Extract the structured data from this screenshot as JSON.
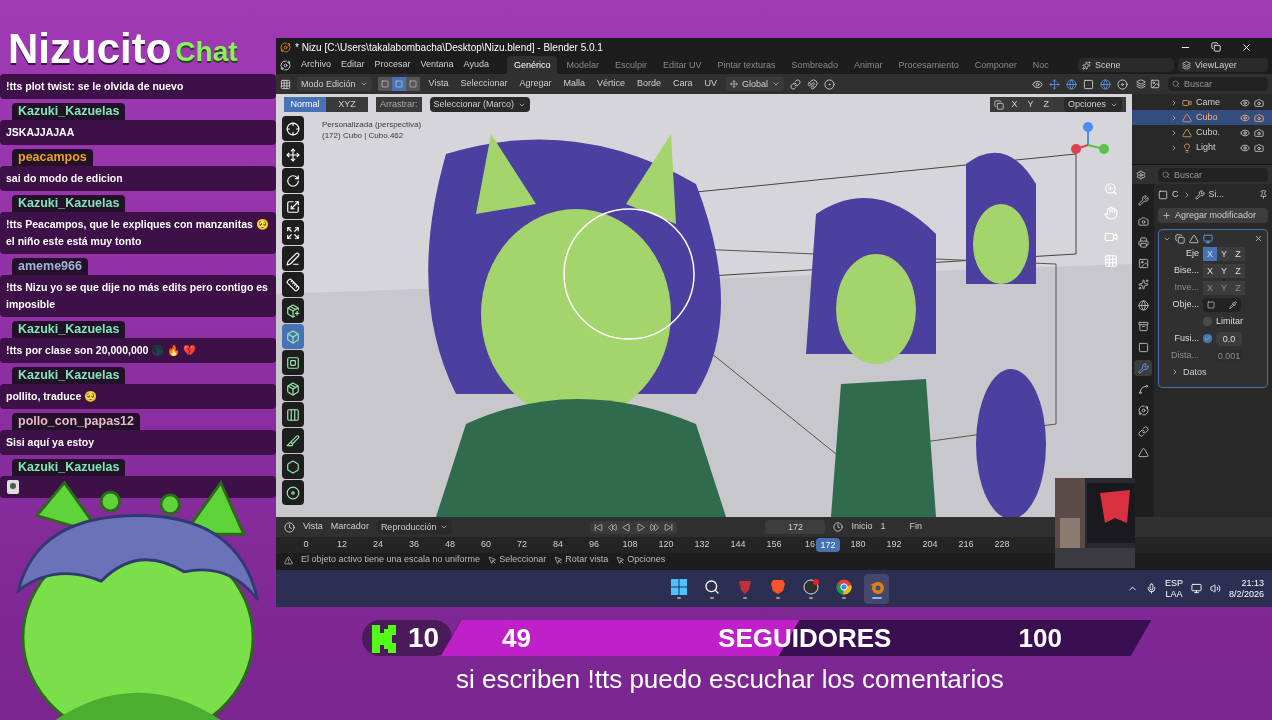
{
  "header": {
    "name": "Nizucito",
    "tag": "Chat"
  },
  "chat": [
    {
      "kind": "text",
      "text": "!tts plot twist: se le olvida de nuevo"
    },
    {
      "kind": "text",
      "user": "Kazuki_Kazuelas",
      "color": "#7ee8b8",
      "text": "JSKAJJAJAA"
    },
    {
      "kind": "text",
      "user": "peacampos",
      "color": "#e8a31c",
      "text": "sai do modo de edicion"
    },
    {
      "kind": "text",
      "user": "Kazuki_Kazuelas",
      "color": "#7ee8b8",
      "text": "!tts Peacampos, que le expliques con manzanitas 🥺 el niño este está muy tonto"
    },
    {
      "kind": "text",
      "user": "ameme966",
      "color": "#9fb4dc",
      "text": "!tts Nizu yo se que dije no más edits pero contigo es imposible"
    },
    {
      "kind": "text",
      "user": "Kazuki_Kazuelas",
      "color": "#7ee8b8",
      "text": "!tts por clase son 20,000,000 🌑 🔥 💔"
    },
    {
      "kind": "text",
      "user": "Kazuki_Kazuelas",
      "color": "#7ee8b8",
      "text": "pollito, traduce 🥺"
    },
    {
      "kind": "text",
      "user": "pollo_con_papas12",
      "color": "#e6b8c8",
      "text": "Sisi aquí ya estoy"
    },
    {
      "kind": "sticker",
      "user": "Kazuki_Kazuelas",
      "color": "#7ee8b8"
    }
  ],
  "blender": {
    "title": "* Nizu [C:\\Users\\takalabombacha\\Desktop\\Nizu.blend] - Blender 5.0.1",
    "menu": [
      "Archivo",
      "Editar",
      "Procesar",
      "Ventana",
      "Ayuda"
    ],
    "workspaces": [
      {
        "label": "Genérico",
        "selected": true
      },
      {
        "label": "Modelar",
        "selected": false
      },
      {
        "label": "Esculpir",
        "selected": false
      },
      {
        "label": "Editar UV",
        "selected": false
      },
      {
        "label": "Pintar texturas",
        "selected": false
      },
      {
        "label": "Sombreado",
        "selected": false
      },
      {
        "label": "Animar",
        "selected": false
      },
      {
        "label": "Procesamiento",
        "selected": false
      },
      {
        "label": "Componer",
        "selected": false
      },
      {
        "label": "Noc",
        "selected": false
      }
    ],
    "scene": "Scene",
    "view_layer": "ViewLayer",
    "mode": "Modo Edición",
    "select_modes": [
      {
        "selected": false
      },
      {
        "selected": true
      },
      {
        "selected": false
      }
    ],
    "header_menu": [
      "Vista",
      "Seleccionar",
      "Agregar",
      "Malla",
      "Vértice",
      "Borde",
      "Cara",
      "UV"
    ],
    "orientation": "Global",
    "orient_tabs": [
      {
        "label": "Normal",
        "selected": true
      },
      {
        "label": "XYZ",
        "selected": false
      }
    ],
    "drag_label": "Arrastrar:",
    "drag_value": "Seleccionar (Marco)",
    "mirror_axes": [
      "X",
      "Y",
      "Z"
    ],
    "options": "Opciones",
    "viewport_info": [
      "Personalizada (perspectiva)",
      "(172) Cubo | Cubo.462"
    ],
    "tools": [
      {
        "kind": "cursor",
        "selected": false
      },
      {
        "kind": "move",
        "selected": false
      },
      {
        "kind": "rotate",
        "selected": false
      },
      {
        "kind": "scale",
        "selected": false
      },
      {
        "kind": "transform",
        "selected": false
      },
      {
        "kind": "annotate",
        "selected": false
      },
      {
        "kind": "measure",
        "selected": false
      },
      {
        "kind": "add",
        "selected": false
      },
      {
        "kind": "extrude",
        "selected": true
      },
      {
        "kind": "inset",
        "selected": false
      },
      {
        "kind": "bevel",
        "selected": false
      },
      {
        "kind": "loopcut",
        "selected": false
      },
      {
        "kind": "knife",
        "selected": false
      },
      {
        "kind": "polybuild",
        "selected": false
      },
      {
        "kind": "spin",
        "selected": false
      }
    ],
    "outliner": {
      "placeholder": "Buscar",
      "items": [
        {
          "label": "Came",
          "kind": "camera",
          "selected": false
        },
        {
          "label": "Cubo",
          "kind": "mesh",
          "selected": true
        },
        {
          "label": "Cubo.",
          "kind": "mesh",
          "selected": false
        },
        {
          "label": "Light",
          "kind": "light",
          "selected": false
        }
      ]
    },
    "properties": {
      "placeholder": "Buscar",
      "tabs": [
        {
          "kind": "tool",
          "selected": false
        },
        {
          "kind": "render",
          "selected": false
        },
        {
          "kind": "output",
          "selected": false
        },
        {
          "kind": "view",
          "selected": false
        },
        {
          "kind": "scene",
          "selected": false
        },
        {
          "kind": "world",
          "selected": false
        },
        {
          "kind": "collection",
          "selected": false
        },
        {
          "kind": "object",
          "selected": false
        },
        {
          "kind": "modifier",
          "selected": true
        },
        {
          "kind": "particles",
          "selected": false
        },
        {
          "kind": "physics",
          "selected": false
        },
        {
          "kind": "constraints",
          "selected": false
        },
        {
          "kind": "data",
          "selected": false
        }
      ],
      "breadcrumb": [
        "C",
        "Si..."
      ],
      "add_button": "Agregar modificador",
      "rows": [
        {
          "kind": "axes",
          "label": "Eje",
          "disabled": false,
          "axes": [
            {
              "label": "X",
              "selected": true
            },
            {
              "label": "Y",
              "selected": false
            },
            {
              "label": "Z",
              "selected": false
            }
          ]
        },
        {
          "kind": "axes",
          "label": "Bise...",
          "disabled": false,
          "axes": [
            {
              "label": "X",
              "selected": false
            },
            {
              "label": "Y",
              "selected": false
            },
            {
              "label": "Z",
              "selected": false
            }
          ]
        },
        {
          "kind": "axes",
          "label": "Inve...",
          "disabled": true,
          "axes": [
            {
              "label": "X",
              "selected": false
            },
            {
              "label": "Y",
              "selected": false
            },
            {
              "label": "Z",
              "selected": false
            }
          ]
        },
        {
          "kind": "object",
          "label": "Obje...",
          "disabled": false
        },
        {
          "kind": "check",
          "label": "Limitar",
          "checked": false,
          "disabled": false
        },
        {
          "kind": "check_value",
          "label": "Fusi...",
          "checked": true,
          "value": "0.0",
          "disabled": false
        },
        {
          "kind": "value",
          "label": "Dista...",
          "value": "0.001",
          "disabled": true
        }
      ],
      "subpanel": "Datos"
    },
    "timeline": {
      "menu": [
        "Vista",
        "Marcador"
      ],
      "playback": "Reproducción",
      "frame": "172",
      "start_label": "Inicio",
      "start": "1",
      "end_label": "Fin",
      "ticks": [
        {
          "label": "0",
          "selected": false
        },
        {
          "label": "12",
          "selected": false
        },
        {
          "label": "24",
          "selected": false
        },
        {
          "label": "36",
          "selected": false
        },
        {
          "label": "48",
          "selected": false
        },
        {
          "label": "60",
          "selected": false
        },
        {
          "label": "72",
          "selected": false
        },
        {
          "label": "84",
          "selected": false
        },
        {
          "label": "96",
          "selected": false
        },
        {
          "label": "108",
          "selected": false
        },
        {
          "label": "120",
          "selected": false
        },
        {
          "label": "132",
          "selected": false
        },
        {
          "label": "144",
          "selected": false
        },
        {
          "label": "156",
          "selected": false
        },
        {
          "label": "16",
          "selected": false
        },
        {
          "label": "172",
          "selected": true
        },
        {
          "label": "180",
          "selected": false
        },
        {
          "label": "192",
          "selected": false
        },
        {
          "label": "204",
          "selected": false
        },
        {
          "label": "216",
          "selected": false
        },
        {
          "label": "228",
          "selected": false
        }
      ]
    },
    "status": {
      "warning": "El objeto activo tiene una escala no uniforme",
      "hints": [
        "Seleccionar",
        "Rotar vista",
        "Opciones"
      ]
    }
  },
  "taskbar": {
    "apps": [
      {
        "kind": "start",
        "selected": false
      },
      {
        "kind": "search",
        "selected": false
      },
      {
        "kind": "app",
        "selected": false
      },
      {
        "kind": "browser",
        "selected": false
      },
      {
        "kind": "recorder",
        "selected": false
      },
      {
        "kind": "chrome",
        "selected": false
      },
      {
        "kind": "blender",
        "selected": true
      }
    ],
    "lang": "ESP",
    "layout": "LAA",
    "time": "21:13",
    "date": "8/2/2026"
  },
  "goal": {
    "count": "10",
    "current": "49",
    "label": "SEGUIDORES",
    "target": "100",
    "level": 0.49
  },
  "subtitle": "si escriben !tts puedo escuchar los comentarios"
}
